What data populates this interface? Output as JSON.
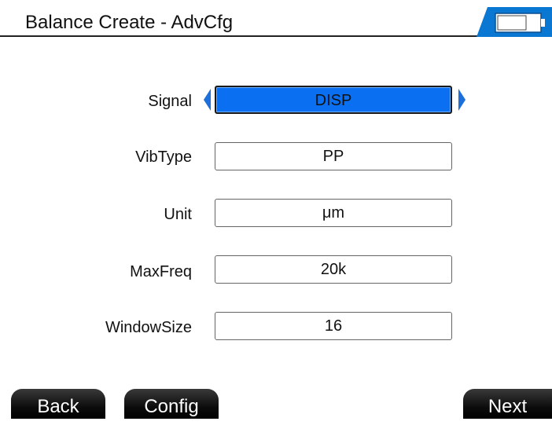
{
  "header": {
    "title": "Balance Create - AdvCfg",
    "battery_icon": "battery-icon"
  },
  "colors": {
    "accent": "#0a6ff0",
    "arrow": "#1e6fd9",
    "softkey": "#000000"
  },
  "form": {
    "signal": {
      "label": "Signal",
      "value": "DISP",
      "prev_icon": "arrow-left-icon",
      "next_icon": "arrow-right-icon"
    },
    "vibtype": {
      "label": "VibType",
      "value": "PP"
    },
    "unit": {
      "label": "Unit",
      "value": "μm"
    },
    "maxfreq": {
      "label": "MaxFreq",
      "value": "20k"
    },
    "windowsize": {
      "label": "WindowSize",
      "value": "16"
    }
  },
  "softkeys": {
    "back": "Back",
    "config": "Config",
    "next": "Next"
  }
}
